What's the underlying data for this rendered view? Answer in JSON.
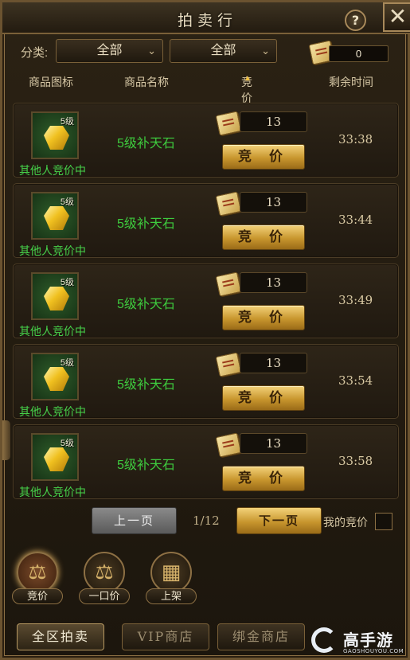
{
  "window": {
    "title": "拍卖行",
    "help": "?",
    "close": "✕"
  },
  "filter": {
    "label": "分类:",
    "category_1": "全部",
    "category_2": "全部",
    "currency_value": "0"
  },
  "headers": {
    "icon": "商品图标",
    "name": "商品名称",
    "price": "竞价",
    "time": "剩余时间"
  },
  "items": [
    {
      "level": "5级",
      "status": "其他人竞价中",
      "name": "5级补天石",
      "price": "13",
      "bid_label": "竞 价",
      "time": "33:38"
    },
    {
      "level": "5级",
      "status": "其他人竞价中",
      "name": "5级补天石",
      "price": "13",
      "bid_label": "竞 价",
      "time": "33:44"
    },
    {
      "level": "5级",
      "status": "其他人竞价中",
      "name": "5级补天石",
      "price": "13",
      "bid_label": "竞 价",
      "time": "33:49"
    },
    {
      "level": "5级",
      "status": "其他人竞价中",
      "name": "5级补天石",
      "price": "13",
      "bid_label": "竞 价",
      "time": "33:54"
    },
    {
      "level": "5级",
      "status": "其他人竞价中",
      "name": "5级补天石",
      "price": "13",
      "bid_label": "竞 价",
      "time": "33:58"
    }
  ],
  "pager": {
    "prev": "上一页",
    "page": "1/12",
    "next": "下一页",
    "my_bids": "我的竞价"
  },
  "modes": [
    {
      "label": "竞价",
      "icon": "gavel-icon"
    },
    {
      "label": "一口价",
      "icon": "scale-icon"
    },
    {
      "label": "上架",
      "icon": "shelf-icon"
    }
  ],
  "tabs": {
    "all": "全区拍卖",
    "vip": "VIP商店",
    "bound": "绑金商店"
  },
  "watermark": {
    "text": "高手游",
    "sub": "GAOSHOUYOU.COM"
  }
}
